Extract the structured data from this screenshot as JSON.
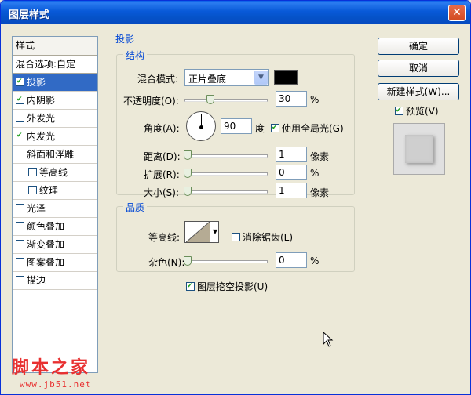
{
  "window": {
    "title": "图层样式",
    "close_glyph": "✕"
  },
  "style_list": {
    "header": "样式",
    "blend_options": "混合选项:自定",
    "items": [
      {
        "label": "投影",
        "checked": true,
        "selected": true
      },
      {
        "label": "内阴影",
        "checked": true
      },
      {
        "label": "外发光",
        "checked": false
      },
      {
        "label": "内发光",
        "checked": true
      },
      {
        "label": "斜面和浮雕",
        "checked": false
      },
      {
        "label": "等高线",
        "checked": false,
        "indent": true
      },
      {
        "label": "纹理",
        "checked": false,
        "indent": true
      },
      {
        "label": "光泽",
        "checked": false
      },
      {
        "label": "颜色叠加",
        "checked": false
      },
      {
        "label": "渐变叠加",
        "checked": false
      },
      {
        "label": "图案叠加",
        "checked": false
      },
      {
        "label": "描边",
        "checked": false
      }
    ]
  },
  "drop_shadow": {
    "section_title": "投影",
    "structure": {
      "title": "结构",
      "blend_mode_label": "混合模式:",
      "blend_mode_value": "正片叠底",
      "shadow_color": "#000000",
      "opacity_label": "不透明度(O):",
      "opacity_value": "30",
      "opacity_unit": "%",
      "opacity_fraction": 0.3,
      "angle_label": "角度(A):",
      "angle_value": "90",
      "angle_unit": "度",
      "global_light_label": "使用全局光(G)",
      "global_light_checked": true,
      "distance_label": "距离(D):",
      "distance_value": "1",
      "distance_unit": "像素",
      "spread_label": "扩展(R):",
      "spread_value": "0",
      "spread_unit": "%",
      "size_label": "大小(S):",
      "size_value": "1",
      "size_unit": "像素"
    },
    "quality": {
      "title": "品质",
      "contour_label": "等高线:",
      "antialias_label": "消除锯齿(L)",
      "antialias_checked": false,
      "noise_label": "杂色(N):",
      "noise_value": "0",
      "noise_unit": "%"
    },
    "knockout_label": "图层挖空投影(U)",
    "knockout_checked": true
  },
  "buttons": {
    "ok": "确定",
    "cancel": "取消",
    "new_style": "新建样式(W)...",
    "preview_label": "预览(V)",
    "preview_checked": true
  },
  "watermark": {
    "brand": "脚本之家",
    "url": "www.jb51.net"
  }
}
